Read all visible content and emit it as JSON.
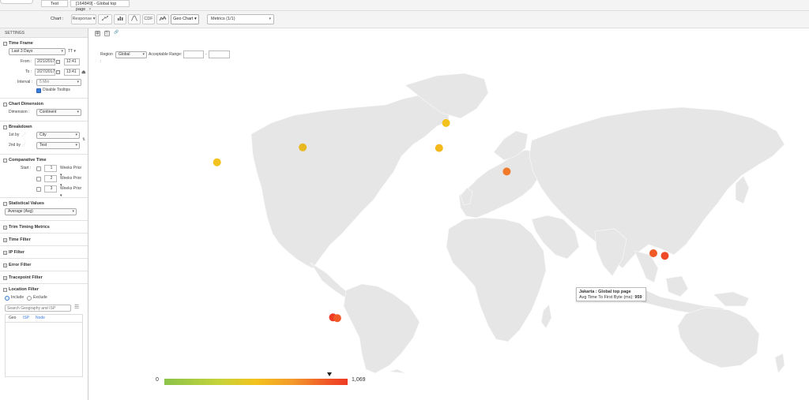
{
  "tabs": [
    {
      "label": "Test"
    },
    {
      "label": "[164849] - Global top page",
      "close": "×"
    }
  ],
  "toolbar": {
    "chart_label": "Chart :",
    "response_label": "Response",
    "cdf_label": "CDF",
    "geo_chart_label": "Geo Chart",
    "metrics_label": "Metrics (1/1)"
  },
  "sidebar": {
    "title": "SETTINGS",
    "time_frame": {
      "heading": "Time Frame",
      "range": "Last 3 Days",
      "tt": "TT",
      "from_label": "From :",
      "from_date": "2/21/2017",
      "from_time": "12:41",
      "to_label": "To :",
      "to_date": "2/27/2017",
      "to_time": "13:41",
      "interval_label": "Interval :",
      "interval": "5 Min",
      "disable_tooltips": "Disable Tooltips"
    },
    "chart_dimension": {
      "heading": "Chart Dimension",
      "dimension_label": "Dimension :",
      "dimension": "Continent"
    },
    "breakdown": {
      "heading": "Breakdown",
      "first_label": "1st by",
      "first": "City",
      "second_label": "2nd by",
      "second": "Test"
    },
    "comparative_time": {
      "heading": "Comparative Time",
      "start_label": "Start :",
      "rows": [
        {
          "num": "1",
          "unit": "Weeks Prior"
        },
        {
          "num": "2",
          "unit": "Weeks Prior"
        },
        {
          "num": "3",
          "unit": "Weeks Prior"
        }
      ]
    },
    "statistical_values": {
      "heading": "Statistical Values",
      "value": "Average (Avg)"
    },
    "collapsed_sections": [
      "Trim Timing Metrics",
      "Time Filter",
      "IP Filter",
      "Error Filter",
      "Tracepoint Filter"
    ],
    "location_filter": {
      "heading": "Location Filter",
      "include": "Include",
      "exclude": "Exclude",
      "search_placeholder": "Search Geography and ISP",
      "tabs": [
        "Geo",
        "ISP",
        "Node"
      ]
    }
  },
  "main": {
    "region_label": "Region :",
    "region": "Global",
    "acceptable_range_label": "Acceptable Range:",
    "range_separator": "-",
    "tooltip": {
      "title": "Jakarta : Global top page",
      "metric_label": "Avg Time To First Byte (ms):",
      "metric_value": "959"
    },
    "legend": {
      "min": "0",
      "max": "1,069"
    }
  },
  "colors": {
    "accent": "#3b7ddd",
    "land": "#e6e6e6",
    "marker_low": "#f3c21c",
    "marker_mid": "#f39a2a",
    "marker_high": "#ef4a27"
  },
  "markers": [
    {
      "city": "Los Angeles",
      "lon": -118.2,
      "lat": 34.1,
      "color": "#f3c21c"
    },
    {
      "city": "New York",
      "lon": -74.0,
      "lat": 40.7,
      "color": "#e8b820"
    },
    {
      "city": "London",
      "lon": -0.1,
      "lat": 51.5,
      "color": "#f3c21c"
    },
    {
      "city": "Madrid",
      "lon": -3.7,
      "lat": 40.4,
      "color": "#f3b81c"
    },
    {
      "city": "Cairo",
      "lon": 31.2,
      "lat": 30.0,
      "color": "#f07a2a"
    },
    {
      "city": "Jakarta",
      "lon": 106.8,
      "lat": -6.2,
      "color": "#ef5a27"
    },
    {
      "city": "Surabaya",
      "lon": 112.7,
      "lat": -7.3,
      "color": "#ef4a27"
    },
    {
      "city": "Buenos Aires",
      "lon": -58.4,
      "lat": -34.6,
      "color": "#ef3a24"
    },
    {
      "city": "Montevideo",
      "lon": -56.2,
      "lat": -34.9,
      "color": "#f05a28"
    }
  ]
}
